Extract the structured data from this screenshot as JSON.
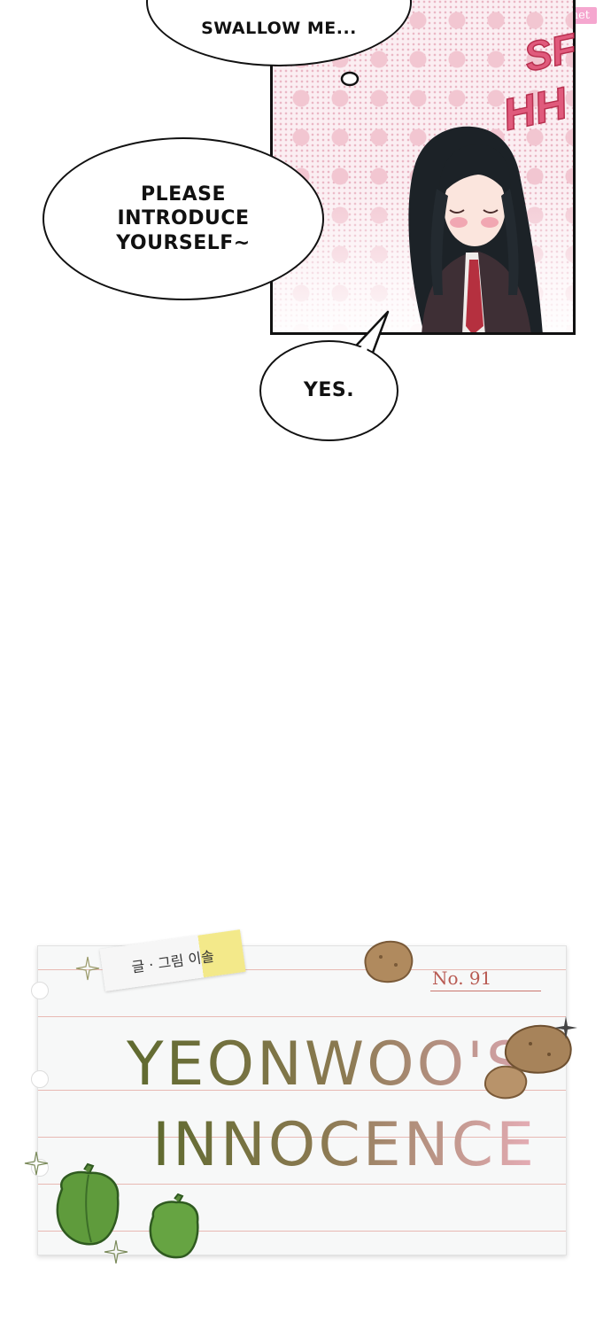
{
  "watermark": "Zinmanga.net",
  "bubbles": {
    "top": "SWALLOW ME...",
    "left": "PLEASE\nINTRODUCE\nYOURSELF~",
    "small": "YES."
  },
  "sfx": [
    "SF",
    "HH"
  ],
  "title_card": {
    "credits": "글 · 그림 이솔",
    "issue": "No.  91",
    "title_line1": "YEONWOO'S",
    "title_line2": "INNOCENCE"
  },
  "colors": {
    "sfx_pink": "#e05a7c",
    "title_green": "#5f6a2f",
    "title_pink": "#e6adb6",
    "issue_red": "#b85a52"
  }
}
